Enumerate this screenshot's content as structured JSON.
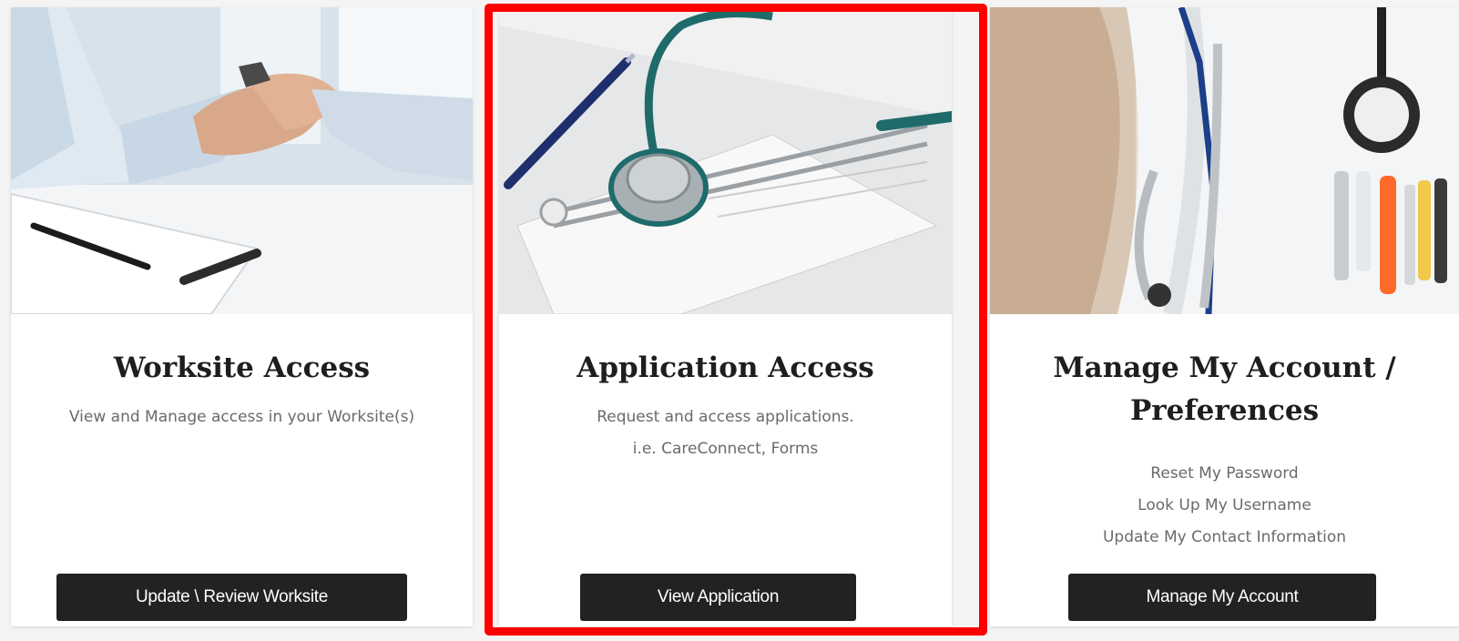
{
  "cards": [
    {
      "title": "Worksite Access",
      "description": [
        "View and Manage access in your Worksite(s)"
      ],
      "button_label": "Update \\ Review Worksite"
    },
    {
      "title": "Application Access",
      "description": [
        "Request and access applications.",
        "i.e. CareConnect, Forms"
      ],
      "button_label": "View Application"
    },
    {
      "title_lines": [
        "Manage My Account /",
        "Preferences"
      ],
      "links": [
        "Reset My Password",
        "Look Up My Username",
        "Update My Contact Information"
      ],
      "button_label": "Manage My Account"
    }
  ],
  "colors": {
    "button_bg": "#222222",
    "highlight": "#ff0000",
    "title": "#1e1e1e",
    "description": "#6a6a6a"
  }
}
